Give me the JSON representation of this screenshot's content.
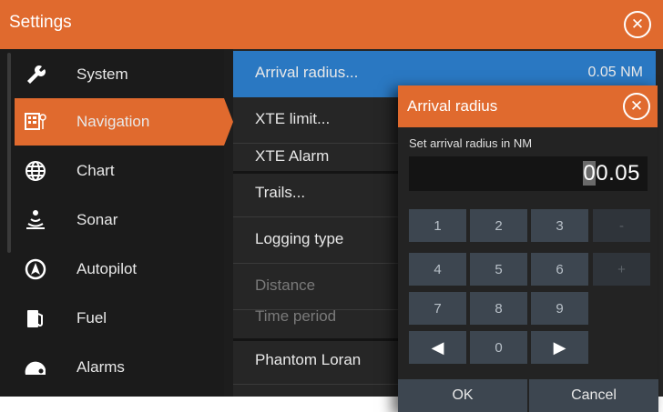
{
  "window": {
    "title": "Settings"
  },
  "sidebar": {
    "items": [
      {
        "label": "System",
        "icon": "wrench-icon",
        "selected": false
      },
      {
        "label": "Navigation",
        "icon": "navigation-icon",
        "selected": true
      },
      {
        "label": "Chart",
        "icon": "globe-icon",
        "selected": false
      },
      {
        "label": "Sonar",
        "icon": "sonar-icon",
        "selected": false
      },
      {
        "label": "Autopilot",
        "icon": "autopilot-icon",
        "selected": false
      },
      {
        "label": "Fuel",
        "icon": "fuel-icon",
        "selected": false
      },
      {
        "label": "Alarms",
        "icon": "alarm-icon",
        "selected": false
      }
    ]
  },
  "settings_list": {
    "items": [
      {
        "label": "Arrival radius...",
        "value": "0.05 NM",
        "selected": true
      },
      {
        "label": "XTE limit..."
      },
      {
        "label": "XTE Alarm"
      },
      {
        "label": "Trails..."
      },
      {
        "label": "Logging type"
      },
      {
        "label": "Distance",
        "disabled": true
      },
      {
        "label": "Time period",
        "disabled": true
      },
      {
        "label": "Phantom Loran"
      }
    ]
  },
  "dialog": {
    "title": "Arrival radius",
    "prompt": "Set arrival radius in NM",
    "value_cursor": "0",
    "value_rest": "0.05",
    "keys": {
      "k1": "1",
      "k2": "2",
      "k3": "3",
      "minus": "-",
      "k4": "4",
      "k5": "5",
      "k6": "6",
      "plus": "+",
      "k7": "7",
      "k8": "8",
      "k9": "9",
      "left": "◀",
      "k0": "0",
      "right": "▶"
    },
    "ok_label": "OK",
    "cancel_label": "Cancel"
  },
  "colors": {
    "accent": "#e06a2e",
    "selection": "#2a78c2",
    "background": "#1d1d1d",
    "keypad": "#3d4650"
  }
}
